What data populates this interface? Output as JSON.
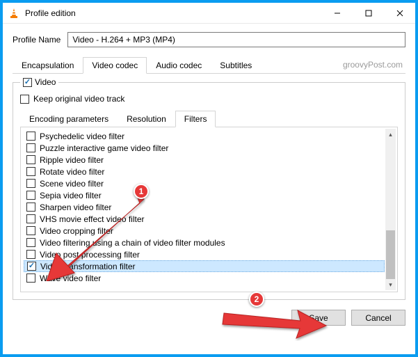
{
  "window": {
    "title": "Profile edition"
  },
  "profile": {
    "label": "Profile Name",
    "value": "Video - H.264 + MP3 (MP4)"
  },
  "outerTabs": [
    "Encapsulation",
    "Video codec",
    "Audio codec",
    "Subtitles"
  ],
  "outerActiveIndex": 1,
  "watermark": "groovyPost.com",
  "group": {
    "legend": "Video",
    "legendChecked": true,
    "keepOriginal": {
      "label": "Keep original video track",
      "checked": false
    }
  },
  "innerTabs": [
    "Encoding parameters",
    "Resolution",
    "Filters"
  ],
  "innerActiveIndex": 2,
  "filters": [
    {
      "label": "Psychedelic video filter",
      "checked": false
    },
    {
      "label": "Puzzle interactive game video filter",
      "checked": false
    },
    {
      "label": "Ripple video filter",
      "checked": false
    },
    {
      "label": "Rotate video filter",
      "checked": false
    },
    {
      "label": "Scene video filter",
      "checked": false
    },
    {
      "label": "Sepia video filter",
      "checked": false
    },
    {
      "label": "Sharpen video filter",
      "checked": false
    },
    {
      "label": "VHS movie effect video filter",
      "checked": false
    },
    {
      "label": "Video cropping filter",
      "checked": false
    },
    {
      "label": "Video filtering using a chain of video filter modules",
      "checked": false
    },
    {
      "label": "Video post processing filter",
      "checked": false
    },
    {
      "label": "Video transformation filter",
      "checked": true,
      "selected": true
    },
    {
      "label": "Wave video filter",
      "checked": false
    }
  ],
  "footer": {
    "save": "Save",
    "cancel": "Cancel"
  },
  "callouts": {
    "one": "1",
    "two": "2"
  }
}
